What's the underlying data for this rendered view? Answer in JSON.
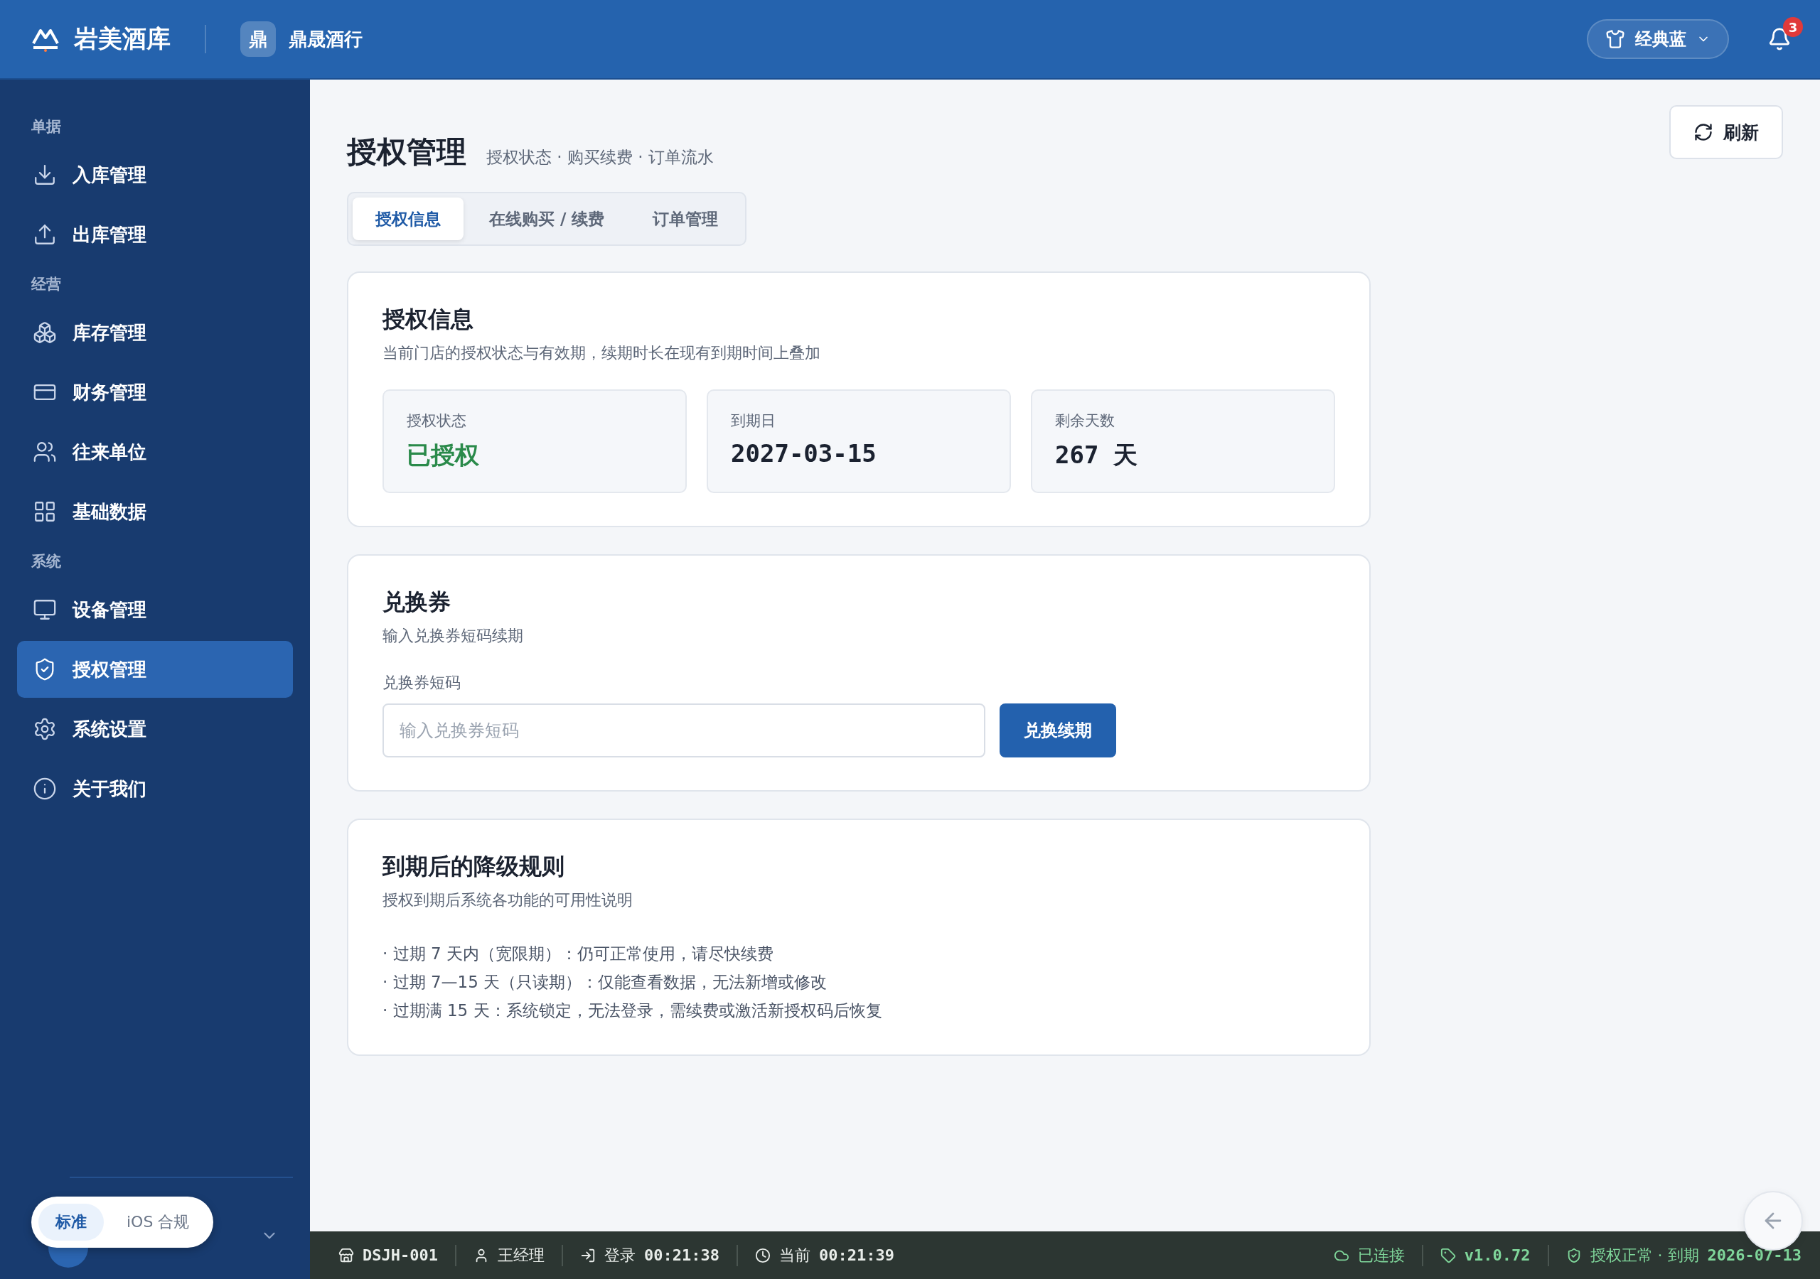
{
  "app": {
    "name": "岩美酒库",
    "store_initial": "鼎",
    "store": "鼎晟酒行"
  },
  "theme_button": {
    "label": "经典蓝"
  },
  "notifications": {
    "count": "3"
  },
  "sidebar": {
    "sections": [
      {
        "title": "单据",
        "items": [
          {
            "label": "入库管理",
            "kind": "download",
            "selected": false
          },
          {
            "label": "出库管理",
            "kind": "upload",
            "selected": false
          }
        ]
      },
      {
        "title": "经营",
        "items": [
          {
            "label": "库存管理",
            "kind": "boxes",
            "selected": false
          },
          {
            "label": "财务管理",
            "kind": "card",
            "selected": false
          },
          {
            "label": "往来单位",
            "kind": "users",
            "selected": false
          },
          {
            "label": "基础数据",
            "kind": "grid",
            "selected": false
          }
        ]
      },
      {
        "title": "系统",
        "items": [
          {
            "label": "设备管理",
            "kind": "monitor",
            "selected": false
          },
          {
            "label": "授权管理",
            "kind": "shield",
            "selected": true
          },
          {
            "label": "系统设置",
            "kind": "settings",
            "selected": false
          },
          {
            "label": "关于我们",
            "kind": "info",
            "selected": false
          }
        ]
      }
    ]
  },
  "mode_toggle": [
    {
      "label": "标准",
      "selected": true
    },
    {
      "label": "iOS 合规",
      "selected": false
    }
  ],
  "page": {
    "title": "授权管理",
    "subtitle": "授权状态 · 购买续费 · 订单流水",
    "refresh": "刷新"
  },
  "tabs": [
    {
      "label": "授权信息",
      "selected": true
    },
    {
      "label": "在线购买 / 续费",
      "selected": false
    },
    {
      "label": "订单管理",
      "selected": false
    }
  ],
  "license_card": {
    "title": "授权信息",
    "description": "当前门店的授权状态与有效期，续期时长在现有到期时间上叠加",
    "stats": [
      {
        "label": "授权状态",
        "value": "已授权",
        "kind": "status"
      },
      {
        "label": "到期日",
        "value": "2027-03-15",
        "kind": "plain"
      },
      {
        "label": "剩余天数",
        "value": "267 天",
        "kind": "plain"
      }
    ]
  },
  "voucher_card": {
    "title": "兑换券",
    "description": "输入兑换券短码续期",
    "field_label": "兑换券短码",
    "placeholder": "输入兑换券短码",
    "button": "兑换续期"
  },
  "rules_card": {
    "title": "到期后的降级规则",
    "description": "授权到期后系统各功能的可用性说明",
    "rules": [
      "· 过期 7 天内（宽限期）：仍可正常使用，请尽快续费",
      "· 过期 7—15 天（只读期）：仅能查看数据，无法新增或修改",
      "· 过期满 15 天：系统锁定，无法登录，需续费或激活新授权码后恢复"
    ]
  },
  "status_bar": {
    "left": [
      {
        "kind": "store",
        "value": "DSJH-001"
      },
      {
        "kind": "user",
        "label": "王经理"
      },
      {
        "kind": "login",
        "label": "登录",
        "value": "00:21:38"
      },
      {
        "kind": "clock",
        "label": "当前",
        "value": "00:21:39"
      }
    ],
    "right": [
      {
        "kind": "cloud",
        "label": "已连接"
      },
      {
        "kind": "tag",
        "value": "v1.0.72"
      },
      {
        "kind": "shield",
        "label": "授权正常 · 到期",
        "value": "2026-07-13"
      }
    ]
  }
}
